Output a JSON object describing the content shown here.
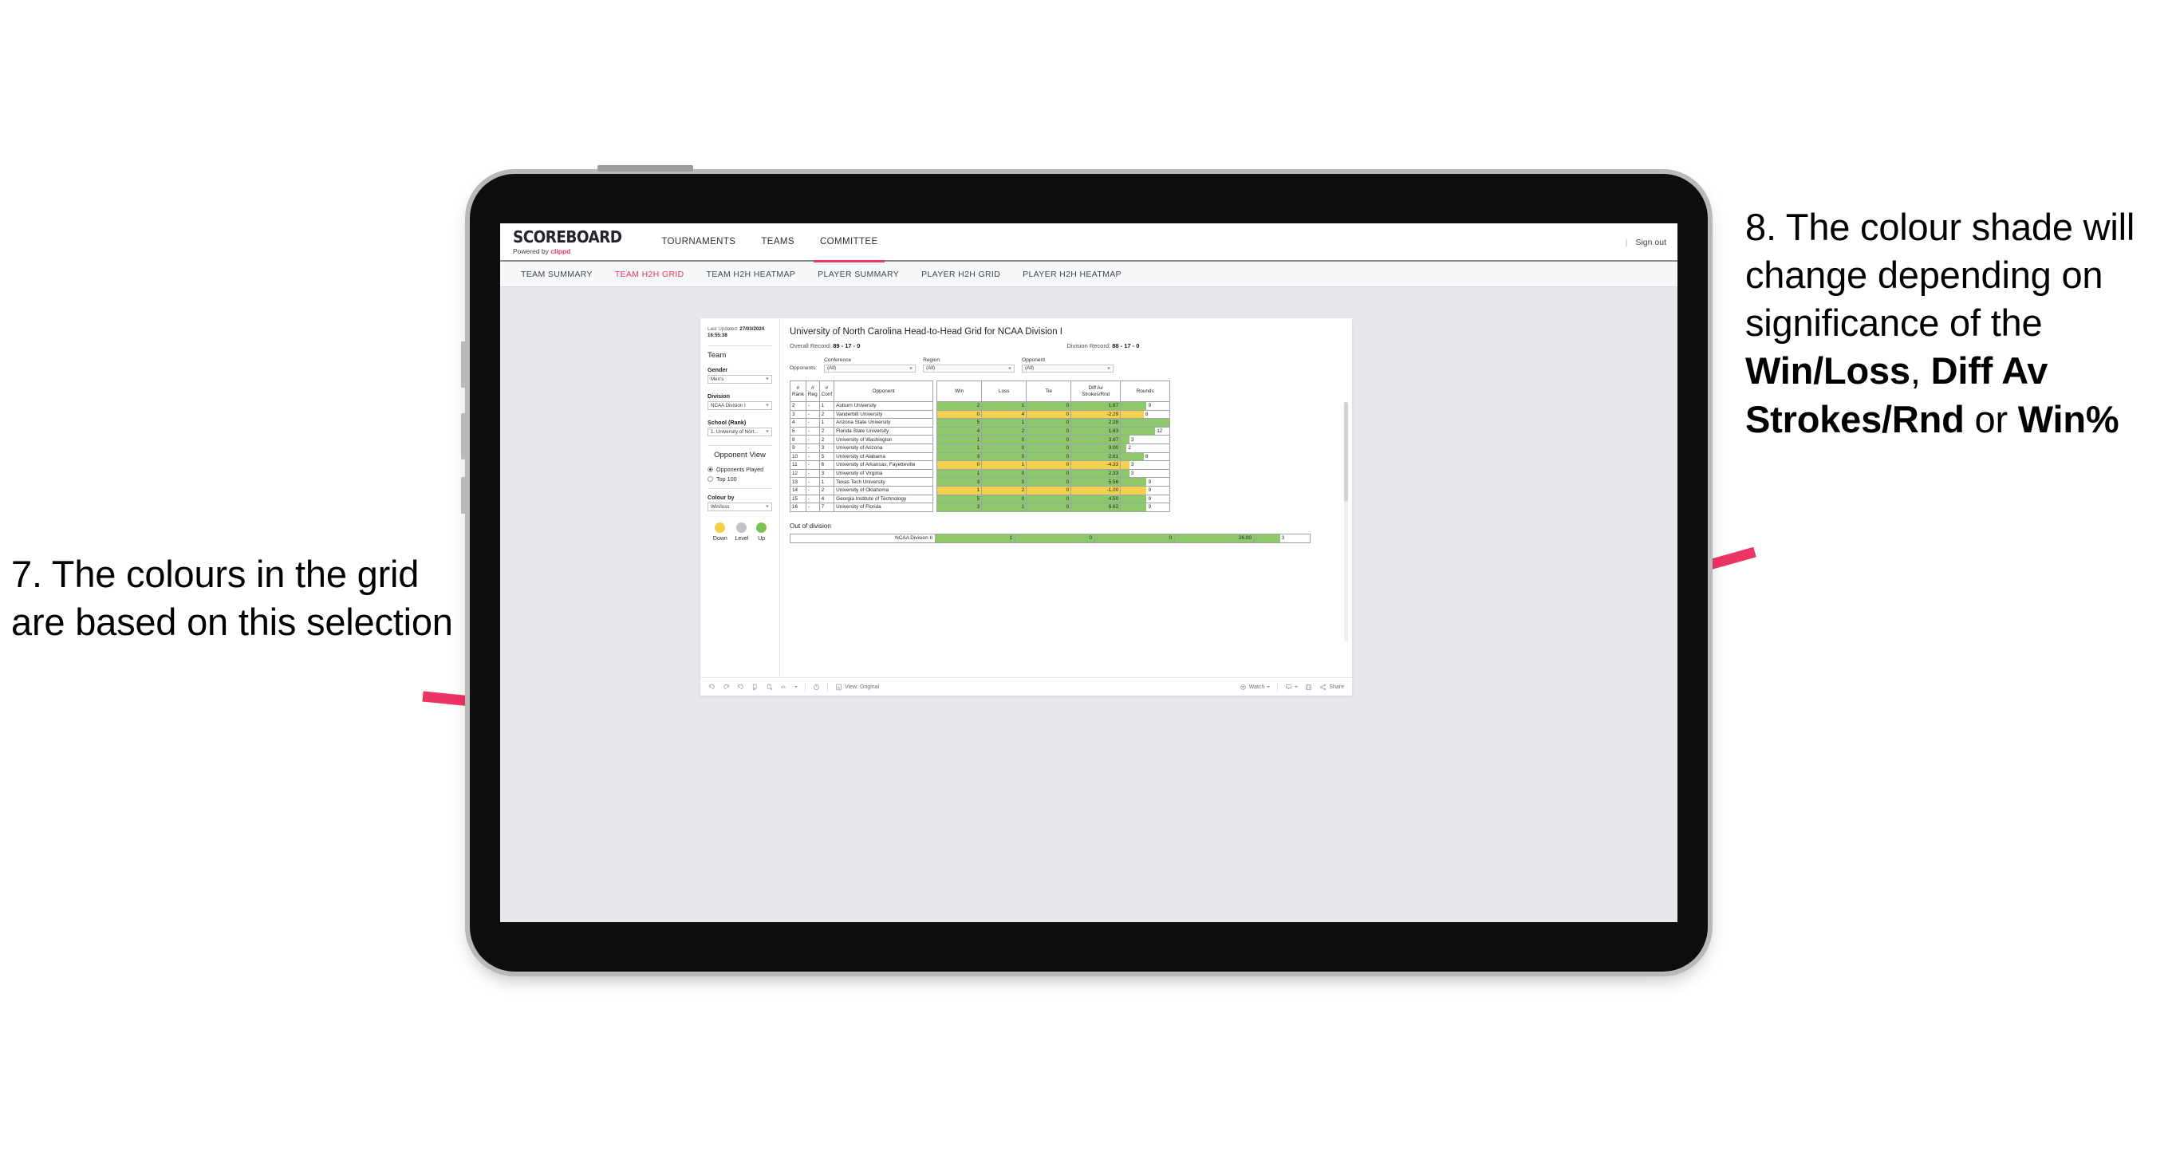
{
  "annotations": {
    "left": {
      "id": "7.",
      "text": "7. The colours in the grid are based on this selection"
    },
    "right": {
      "line1": "8. The colour shade will change depending on significance of the ",
      "bold1": "Win/Loss",
      "mid1": ", ",
      "bold2": "Diff Av Strokes/Rnd",
      "mid2": " or ",
      "bold3": "Win%"
    },
    "arrow_color": "#e8395e"
  },
  "app": {
    "brand": {
      "name": "SCOREBOARD",
      "powered_prefix": "Powered by ",
      "powered_brand": "clippd"
    },
    "top_nav": [
      {
        "label": "TOURNAMENTS",
        "active": false
      },
      {
        "label": "TEAMS",
        "active": false
      },
      {
        "label": "COMMITTEE",
        "active": true
      }
    ],
    "top_right": {
      "separator": "|",
      "sign_out": "Sign out"
    },
    "sub_nav": [
      {
        "label": "TEAM SUMMARY",
        "active": false
      },
      {
        "label": "TEAM H2H GRID",
        "active": true
      },
      {
        "label": "TEAM H2H HEATMAP",
        "active": false
      },
      {
        "label": "PLAYER SUMMARY",
        "active": false
      },
      {
        "label": "PLAYER H2H GRID",
        "active": false
      },
      {
        "label": "PLAYER H2H HEATMAP",
        "active": false
      }
    ]
  },
  "pane": {
    "last_updated_label": "Last Updated: ",
    "last_updated_value": "27/03/2024 16:55:38",
    "team_heading": "Team",
    "gender": {
      "label": "Gender",
      "value": "Men's"
    },
    "division": {
      "label": "Division",
      "value": "NCAA Division I"
    },
    "school": {
      "label": "School (Rank)",
      "value": "1. University of Nort..."
    },
    "opponent_view": {
      "heading": "Opponent View",
      "options": [
        {
          "label": "Opponents Played",
          "selected": true
        },
        {
          "label": "Top 100",
          "selected": false
        }
      ]
    },
    "colour_by": {
      "label": "Colour by",
      "value": "Win/loss"
    },
    "legend": [
      {
        "label": "Down",
        "color": "#f2cf45"
      },
      {
        "label": "Level",
        "color": "#bfc2c7"
      },
      {
        "label": "Up",
        "color": "#7fc155"
      }
    ]
  },
  "main": {
    "title": "University of North Carolina Head-to-Head Grid for NCAA Division I",
    "overall_record": {
      "label": "Overall Record: ",
      "value": "89 - 17 - 0"
    },
    "division_record": {
      "label": "Division Record: ",
      "value": "88 - 17 - 0"
    },
    "filters_lead": "Opponents:",
    "filters": [
      {
        "label": "Conference",
        "value": "(All)"
      },
      {
        "label": "Region",
        "value": "(All)"
      },
      {
        "label": "Opponent",
        "value": "(All)"
      }
    ],
    "columns": [
      "# Rank",
      "# Reg",
      "# Conf",
      "Opponent",
      "Win",
      "Loss",
      "Tie",
      "Diff Av Strokes/Rnd",
      "Rounds"
    ],
    "columns_split": [
      {
        "l1": "#",
        "l2": "Rank"
      },
      {
        "l1": "#",
        "l2": "Reg"
      },
      {
        "l1": "#",
        "l2": "Conf"
      },
      {
        "l1": "Opponent",
        "l2": ""
      },
      {
        "l1": "Win",
        "l2": ""
      },
      {
        "l1": "Loss",
        "l2": ""
      },
      {
        "l1": "Tie",
        "l2": ""
      },
      {
        "l1": "Diff Av",
        "l2": "Strokes/Rnd"
      },
      {
        "l1": "Rounds",
        "l2": ""
      }
    ],
    "rows": [
      {
        "rank": "2",
        "reg": "-",
        "conf": "1",
        "opponent": "Auburn University",
        "win": "2",
        "loss": "1",
        "tie": "0",
        "diff": "1.67",
        "rounds": "9",
        "result": "up"
      },
      {
        "rank": "3",
        "reg": "-",
        "conf": "2",
        "opponent": "Vanderbilt University",
        "win": "0",
        "loss": "4",
        "tie": "0",
        "diff": "-2.29",
        "rounds": "8",
        "result": "down"
      },
      {
        "rank": "4",
        "reg": "-",
        "conf": "1",
        "opponent": "Arizona State University",
        "win": "5",
        "loss": "1",
        "tie": "0",
        "diff": "2.28",
        "rounds": "17",
        "result": "up"
      },
      {
        "rank": "6",
        "reg": "-",
        "conf": "2",
        "opponent": "Florida State University",
        "win": "4",
        "loss": "2",
        "tie": "0",
        "diff": "1.83",
        "rounds": "12",
        "result": "up"
      },
      {
        "rank": "8",
        "reg": "-",
        "conf": "2",
        "opponent": "University of Washington",
        "win": "1",
        "loss": "0",
        "tie": "0",
        "diff": "3.67",
        "rounds": "3",
        "result": "up"
      },
      {
        "rank": "9",
        "reg": "-",
        "conf": "3",
        "opponent": "University of Arizona",
        "win": "1",
        "loss": "0",
        "tie": "0",
        "diff": "9.00",
        "rounds": "2",
        "result": "up"
      },
      {
        "rank": "10",
        "reg": "-",
        "conf": "5",
        "opponent": "University of Alabama",
        "win": "3",
        "loss": "0",
        "tie": "0",
        "diff": "2.61",
        "rounds": "8",
        "result": "up"
      },
      {
        "rank": "11",
        "reg": "-",
        "conf": "6",
        "opponent": "University of Arkansas, Fayetteville",
        "win": "0",
        "loss": "1",
        "tie": "0",
        "diff": "-4.33",
        "rounds": "3",
        "result": "down"
      },
      {
        "rank": "12",
        "reg": "-",
        "conf": "3",
        "opponent": "University of Virginia",
        "win": "1",
        "loss": "0",
        "tie": "0",
        "diff": "2.33",
        "rounds": "3",
        "result": "up"
      },
      {
        "rank": "13",
        "reg": "-",
        "conf": "1",
        "opponent": "Texas Tech University",
        "win": "3",
        "loss": "0",
        "tie": "0",
        "diff": "5.56",
        "rounds": "9",
        "result": "up"
      },
      {
        "rank": "14",
        "reg": "-",
        "conf": "2",
        "opponent": "University of Oklahoma",
        "win": "1",
        "loss": "2",
        "tie": "0",
        "diff": "-1.00",
        "rounds": "9",
        "result": "down"
      },
      {
        "rank": "15",
        "reg": "-",
        "conf": "4",
        "opponent": "Georgia Institute of Technology",
        "win": "5",
        "loss": "0",
        "tie": "0",
        "diff": "4.50",
        "rounds": "9",
        "result": "up"
      },
      {
        "rank": "16",
        "reg": "-",
        "conf": "7",
        "opponent": "University of Florida",
        "win": "3",
        "loss": "1",
        "tie": "0",
        "diff": "6.62",
        "rounds": "9",
        "result": "up"
      }
    ],
    "out_of_division": {
      "heading": "Out of division",
      "row": {
        "name": "NCAA Division II",
        "win": "1",
        "loss": "0",
        "tie": "0",
        "diff": "26.00",
        "rounds": "3",
        "result": "up"
      }
    }
  },
  "toolbar": {
    "undo": "undo-icon",
    "redo": "redo-icon",
    "revert": "revert-icon",
    "refresh": "refresh-icon",
    "pause": "pause-icon",
    "alerts": "alerts-icon",
    "view_label": "View: Original",
    "watch_label": "Watch",
    "share_label": "Share"
  },
  "chart_data": {
    "type": "table",
    "title": "University of North Carolina Head-to-Head Grid for NCAA Division I",
    "colour_by": "Win/loss",
    "colour_scale": {
      "down": "#f2cf45",
      "level": "#bfc2c7",
      "up": "#7fc155"
    },
    "columns": [
      "#Rank",
      "#Reg",
      "#Conf",
      "Opponent",
      "Win",
      "Loss",
      "Tie",
      "Diff Av Strokes/Rnd",
      "Rounds"
    ],
    "values": [
      [
        "2",
        "-",
        "1",
        "Auburn University",
        2,
        1,
        0,
        1.67,
        9
      ],
      [
        "3",
        "-",
        "2",
        "Vanderbilt University",
        0,
        4,
        0,
        -2.29,
        8
      ],
      [
        "4",
        "-",
        "1",
        "Arizona State University",
        5,
        1,
        0,
        2.28,
        17
      ],
      [
        "6",
        "-",
        "2",
        "Florida State University",
        4,
        2,
        0,
        1.83,
        12
      ],
      [
        "8",
        "-",
        "2",
        "University of Washington",
        1,
        0,
        0,
        3.67,
        3
      ],
      [
        "9",
        "-",
        "3",
        "University of Arizona",
        1,
        0,
        0,
        9.0,
        2
      ],
      [
        "10",
        "-",
        "5",
        "University of Alabama",
        3,
        0,
        0,
        2.61,
        8
      ],
      [
        "11",
        "-",
        "6",
        "University of Arkansas, Fayetteville",
        0,
        1,
        0,
        -4.33,
        3
      ],
      [
        "12",
        "-",
        "3",
        "University of Virginia",
        1,
        0,
        0,
        2.33,
        3
      ],
      [
        "13",
        "-",
        "1",
        "Texas Tech University",
        3,
        0,
        0,
        5.56,
        9
      ],
      [
        "14",
        "-",
        "2",
        "University of Oklahoma",
        1,
        2,
        0,
        -1.0,
        9
      ],
      [
        "15",
        "-",
        "4",
        "Georgia Institute of Technology",
        5,
        0,
        0,
        4.5,
        9
      ],
      [
        "16",
        "-",
        "7",
        "University of Florida",
        3,
        1,
        0,
        6.62,
        9
      ]
    ],
    "out_of_division": [
      [
        "NCAA Division II",
        1,
        0,
        0,
        26.0,
        3
      ]
    ],
    "overall_record": "89 - 17 - 0",
    "division_record": "88 - 17 - 0",
    "rounds_axis_max": 17
  }
}
